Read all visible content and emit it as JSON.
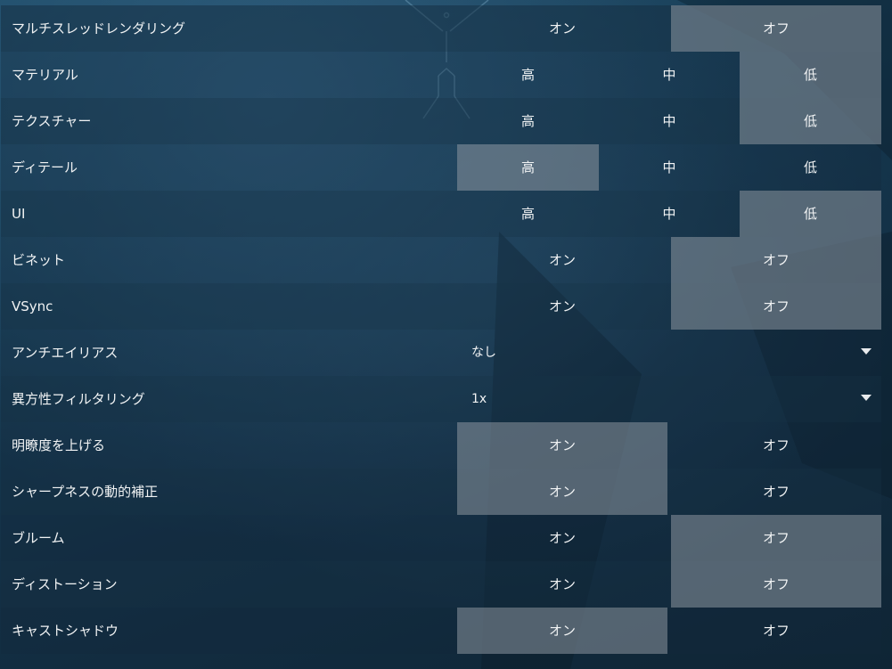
{
  "settings": [
    {
      "label": "マルチスレッドレンダリング",
      "type": "toggle",
      "options": [
        "オン",
        "オフ"
      ],
      "selected": 1
    },
    {
      "label": "マテリアル",
      "type": "triple",
      "options": [
        "高",
        "中",
        "低"
      ],
      "selected": 2
    },
    {
      "label": "テクスチャー",
      "type": "triple",
      "options": [
        "高",
        "中",
        "低"
      ],
      "selected": 2
    },
    {
      "label": "ディテール",
      "type": "triple",
      "options": [
        "高",
        "中",
        "低"
      ],
      "selected": 0
    },
    {
      "label": "UI",
      "type": "triple",
      "options": [
        "高",
        "中",
        "低"
      ],
      "selected": 2
    },
    {
      "label": "ビネット",
      "type": "toggle",
      "options": [
        "オン",
        "オフ"
      ],
      "selected": 1
    },
    {
      "label": "VSync",
      "type": "toggle",
      "options": [
        "オン",
        "オフ"
      ],
      "selected": 1
    },
    {
      "label": "アンチエイリアス",
      "type": "dropdown",
      "value": "なし"
    },
    {
      "label": "異方性フィルタリング",
      "type": "dropdown",
      "value": "1x"
    },
    {
      "label": "明瞭度を上げる",
      "type": "toggle",
      "options": [
        "オン",
        "オフ"
      ],
      "selected": 0
    },
    {
      "label": "シャープネスの動的補正",
      "type": "toggle",
      "options": [
        "オン",
        "オフ"
      ],
      "selected": 0
    },
    {
      "label": "ブルーム",
      "type": "toggle",
      "options": [
        "オン",
        "オフ"
      ],
      "selected": 1
    },
    {
      "label": "ディストーション",
      "type": "toggle",
      "options": [
        "オン",
        "オフ"
      ],
      "selected": 1
    },
    {
      "label": "キャストシャドウ",
      "type": "toggle",
      "options": [
        "オン",
        "オフ"
      ],
      "selected": 0
    }
  ],
  "icons": {
    "dropdown": "caret-down-icon",
    "background_emblem": "emblem-logo"
  },
  "colors": {
    "text": "#f1f3f4",
    "selected_bg": "#7d8a94",
    "background": "#163a52"
  }
}
